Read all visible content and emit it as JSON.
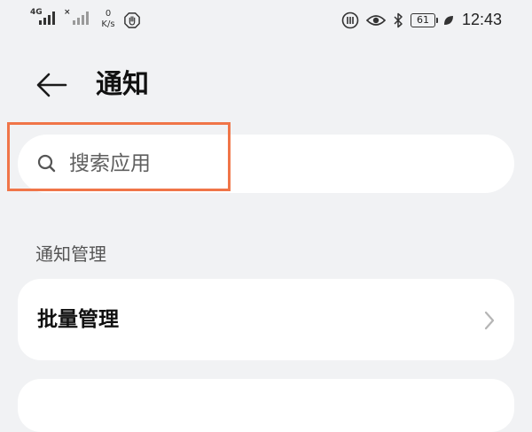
{
  "status_bar": {
    "signal1_label": "4G",
    "signal2_label": "×",
    "speed_value": "0",
    "speed_unit": "K/s",
    "battery_level": "61",
    "time": "12:43"
  },
  "header": {
    "title": "通知"
  },
  "search": {
    "placeholder": "搜索应用"
  },
  "section": {
    "title": "通知管理"
  },
  "items": [
    {
      "label": "批量管理"
    }
  ],
  "colors": {
    "background": "#f1f2f4",
    "card": "#ffffff",
    "highlight": "#f07548"
  },
  "icons": {
    "back": "arrow-left-icon",
    "search": "search-icon",
    "chevron": "chevron-right-icon"
  }
}
